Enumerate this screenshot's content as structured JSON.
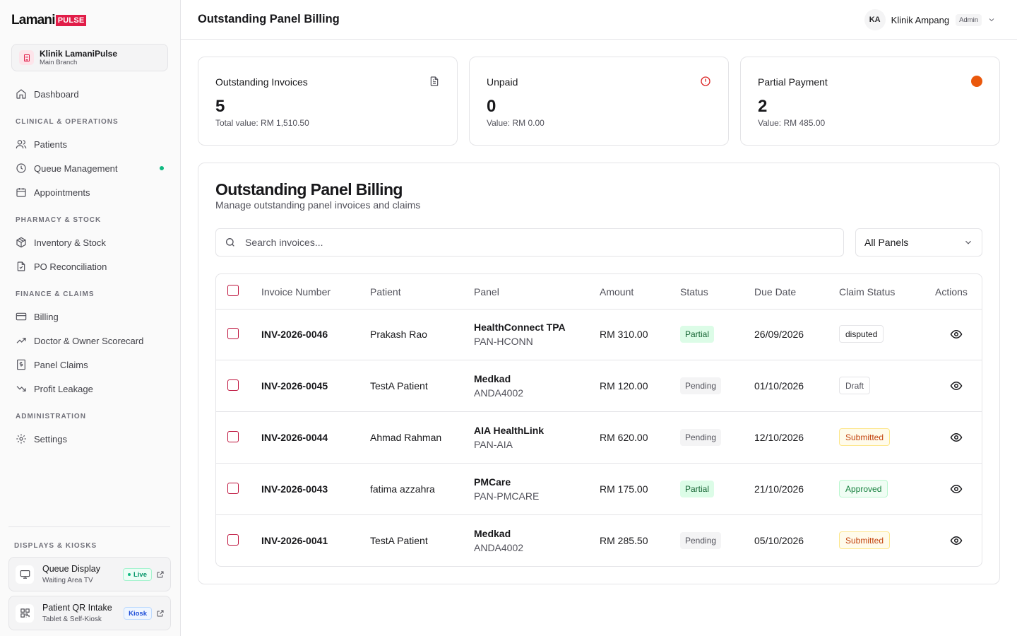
{
  "brand": {
    "name": "Lamani",
    "badge": "PULSE"
  },
  "clinic": {
    "name": "Klinik LamaniPulse",
    "branch": "Main Branch"
  },
  "nav": {
    "dashboard": "Dashboard",
    "sections": [
      "CLINICAL & OPERATIONS",
      "PHARMACY & STOCK",
      "FINANCE & CLAIMS",
      "ADMINISTRATION"
    ],
    "items": [
      "Patients",
      "Queue Management",
      "Appointments",
      "Inventory & Stock",
      "PO Reconciliation",
      "Billing",
      "Doctor & Owner Scorecard",
      "Panel Claims",
      "Profit Leakage",
      "Settings"
    ]
  },
  "displays": {
    "section": "DISPLAYS & KIOSKS",
    "queue": {
      "title": "Queue Display",
      "sub": "Waiting Area TV",
      "pill": "Live"
    },
    "qr": {
      "title": "Patient QR Intake",
      "sub": "Tablet & Self-Kiosk",
      "pill": "Kiosk"
    }
  },
  "header": {
    "title": "Outstanding Panel Billing",
    "initials": "KA",
    "user": "Klinik Ampang",
    "role": "Admin"
  },
  "stats": [
    {
      "title": "Outstanding Invoices",
      "value": "5",
      "sub": "Total value: RM 1,510.50",
      "icon": "document-icon"
    },
    {
      "title": "Unpaid",
      "value": "0",
      "sub": "Value: RM 0.00",
      "icon": "alert-circle-icon"
    },
    {
      "title": "Partial Payment",
      "value": "2",
      "sub": "Value: RM 485.00",
      "icon": "orange-dot-icon"
    }
  ],
  "main": {
    "title": "Outstanding Panel Billing",
    "subtitle": "Manage outstanding panel invoices and claims",
    "search_placeholder": "Search invoices...",
    "filter": "All Panels"
  },
  "table": {
    "columns": [
      "Invoice Number",
      "Patient",
      "Panel",
      "Amount",
      "Status",
      "Due Date",
      "Claim Status",
      "Actions"
    ],
    "rows": [
      {
        "invoice": "INV-2026-0046",
        "patient": "Prakash Rao",
        "panel": "HealthConnect TPA",
        "code": "PAN-HCONN",
        "amount": "RM 310.00",
        "status": "Partial",
        "due": "26/09/2026",
        "claim": "disputed"
      },
      {
        "invoice": "INV-2026-0045",
        "patient": "TestA Patient",
        "panel": "Medkad",
        "code": "ANDA4002",
        "amount": "RM 120.00",
        "status": "Pending",
        "due": "01/10/2026",
        "claim": "Draft"
      },
      {
        "invoice": "INV-2026-0044",
        "patient": "Ahmad Rahman",
        "panel": "AIA HealthLink",
        "code": "PAN-AIA",
        "amount": "RM 620.00",
        "status": "Pending",
        "due": "12/10/2026",
        "claim": "Submitted"
      },
      {
        "invoice": "INV-2026-0043",
        "patient": "fatima azzahra",
        "panel": "PMCare",
        "code": "PAN-PMCARE",
        "amount": "RM 175.00",
        "status": "Partial",
        "due": "21/10/2026",
        "claim": "Approved"
      },
      {
        "invoice": "INV-2026-0041",
        "patient": "TestA Patient",
        "panel": "Medkad",
        "code": "ANDA4002",
        "amount": "RM 285.50",
        "status": "Pending",
        "due": "05/10/2026",
        "claim": "Submitted"
      }
    ]
  },
  "colors": {
    "accent": "#e11d48",
    "checkbox": "#be123c",
    "live": "#10b981",
    "partial_dot": "#ea580c"
  }
}
